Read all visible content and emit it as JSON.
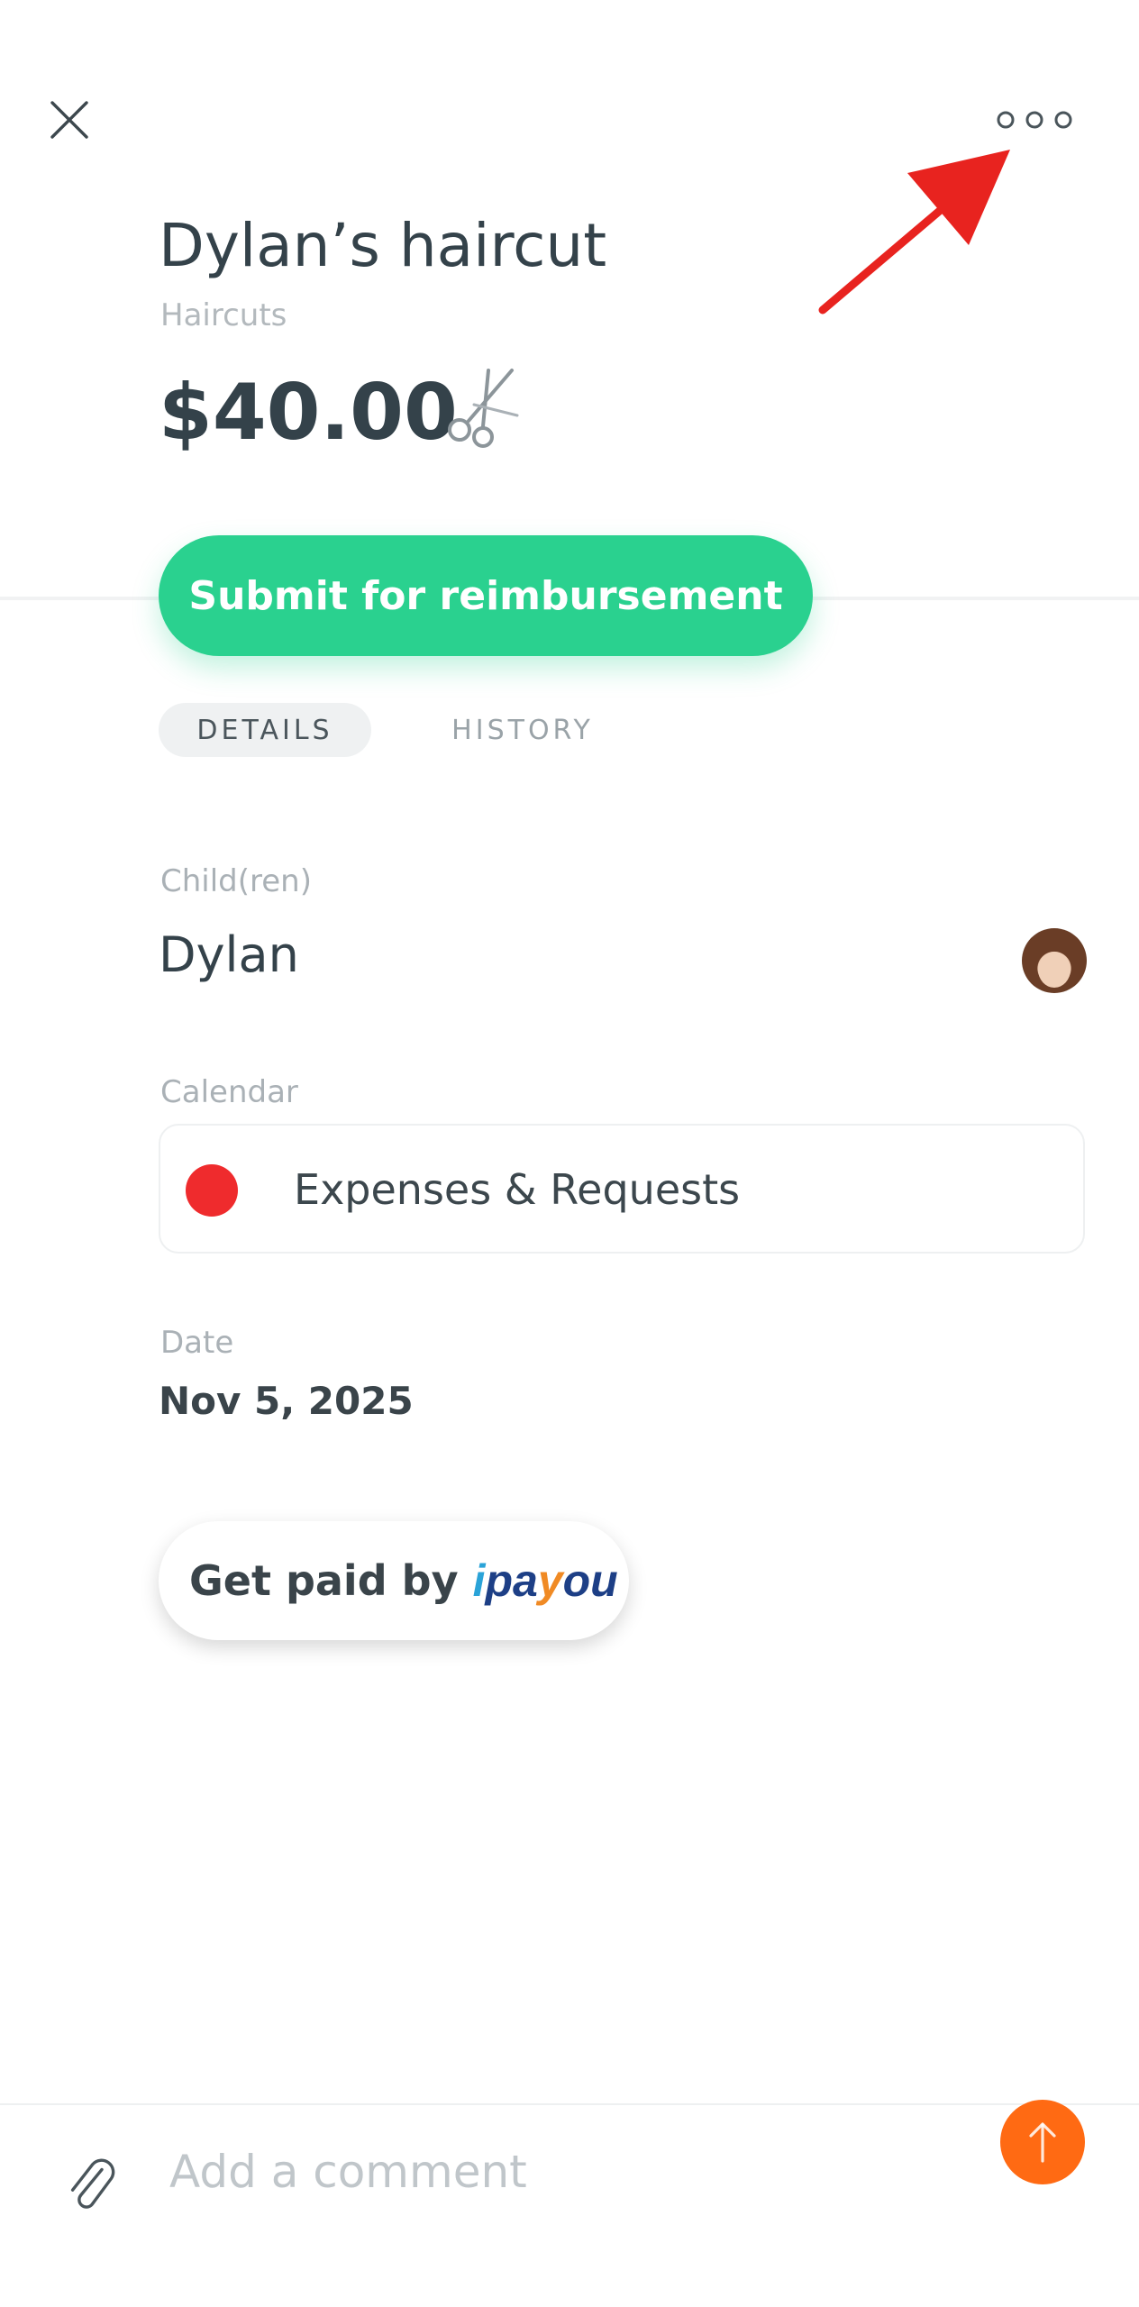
{
  "header": {
    "title": "Dylan’s haircut",
    "category": "Haircuts",
    "amount": "$40.00",
    "amount_icon": "scissors-icon"
  },
  "actions": {
    "submit_label": "Submit for reimbursement"
  },
  "tabs": [
    {
      "label": "DETAILS",
      "active": true
    },
    {
      "label": "HISTORY",
      "active": false
    }
  ],
  "details": {
    "children_label": "Child(ren)",
    "children_value": "Dylan",
    "calendar_label": "Calendar",
    "calendar_value": "Expenses & Requests",
    "calendar_color": "#ef2b2d",
    "date_label": "Date",
    "date_value": "Nov 5, 2025"
  },
  "payment": {
    "label": "Get paid by",
    "brand_i": "i",
    "brand_pa": "pa",
    "brand_y": "y",
    "brand_ou": "ou"
  },
  "comment": {
    "placeholder": "Add a comment"
  },
  "colors": {
    "accent_green": "#2ad18f",
    "send_orange": "#ff6a13",
    "annotation_red": "#e8231f"
  }
}
